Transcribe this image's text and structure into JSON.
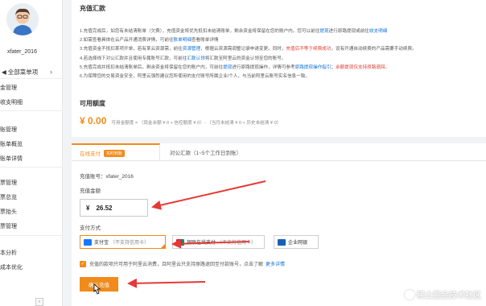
{
  "sidebar": {
    "username": "xfater_2016",
    "all_menu": "全部菜单项",
    "items": [
      "金管理",
      "收支明细",
      "账管理",
      "账单概览",
      "账单详情",
      "票管理",
      "票总览",
      "票抬头",
      "票管理",
      "本分析",
      "成本优化"
    ]
  },
  "notes_title": "充值汇款",
  "notes": [
    {
      "pre": "1.充值完成后，如您有未结清账单（欠费），充值资金将优先抵扣未结清账单，剩余资金将保留在您的账户内。您可以前往",
      "link": "提现",
      "post": "进行原路提现或前往",
      "link2": "收支明细"
    },
    {
      "pre": "2.如需查看具体在云产品开通消费详情，可前往",
      "link": "账单明细",
      "post": "查看账单详情"
    },
    {
      "pre": "3.充值资金不抵扣某项开单，若有某云资源需，前往",
      "link": "资源管理",
      "post": "，根据云资源需调整记录申请变更。同时，",
      "red": "充值后不等于续费成功",
      "post2": "，设有开通自动续费的产品需要手动续费。"
    },
    {
      "pre": "4.若选择线下对公汇款并且使用专属账号汇款，可前往",
      "link": "汇款认领",
      "post": "将汇款至阿里云的资金认领至您的账号。"
    },
    {
      "pre": "5.充值完成并抵扣未结清账单后，剩余资金将保留在您的账户内，可前往",
      "link": "提现",
      "post": "进行原路提现操作，详情可参考",
      "link2": "原路提现操作指引",
      "red": "；余额提现仅支持原路退回。"
    },
    {
      "pre": "6.为保障您的交易资金安全，阿里云强烈建议您所使用的支付账号所属企业/个人，与当前阿里云账号实名信息一致。"
    }
  ],
  "balance": {
    "title": "可用额度",
    "amount": "¥ 0.00",
    "desc": "可用金额度 = （现金余额 ¥ 0 + 信控额度 ¥ 0）- （当月未结清 ¥ 0 + 历史未结清 ¥ 0）"
  },
  "tabs": {
    "active": "在线支付",
    "badge": "实时到账",
    "other": "对公汇款（1~5个工作日到账）"
  },
  "form": {
    "account_label": "充值账号：",
    "account_value": "xfater_2016",
    "amount_label": "充值金额",
    "currency": "¥",
    "amount_value": "26.52",
    "pay_label": "支付方式",
    "pay_options": [
      {
        "name": "支付宝",
        "note": "（不支持信用卡）"
      },
      {
        "name": "银联在线支付",
        "note": "（不支持信用卡）"
      },
      {
        "name": "企业网银",
        "note": ""
      }
    ],
    "agree_text": "充值的款项只可用于阿里云消费，且阿里云只支持原路退回至付款账号，点击了解",
    "agree_link": "更多详情",
    "submit": "确认充值"
  },
  "watermark": "稀土掘金技术社区",
  "colors": {
    "accent": "#f08b1c",
    "link": "#0a70d8",
    "annotation_arrow": "#e53935"
  }
}
